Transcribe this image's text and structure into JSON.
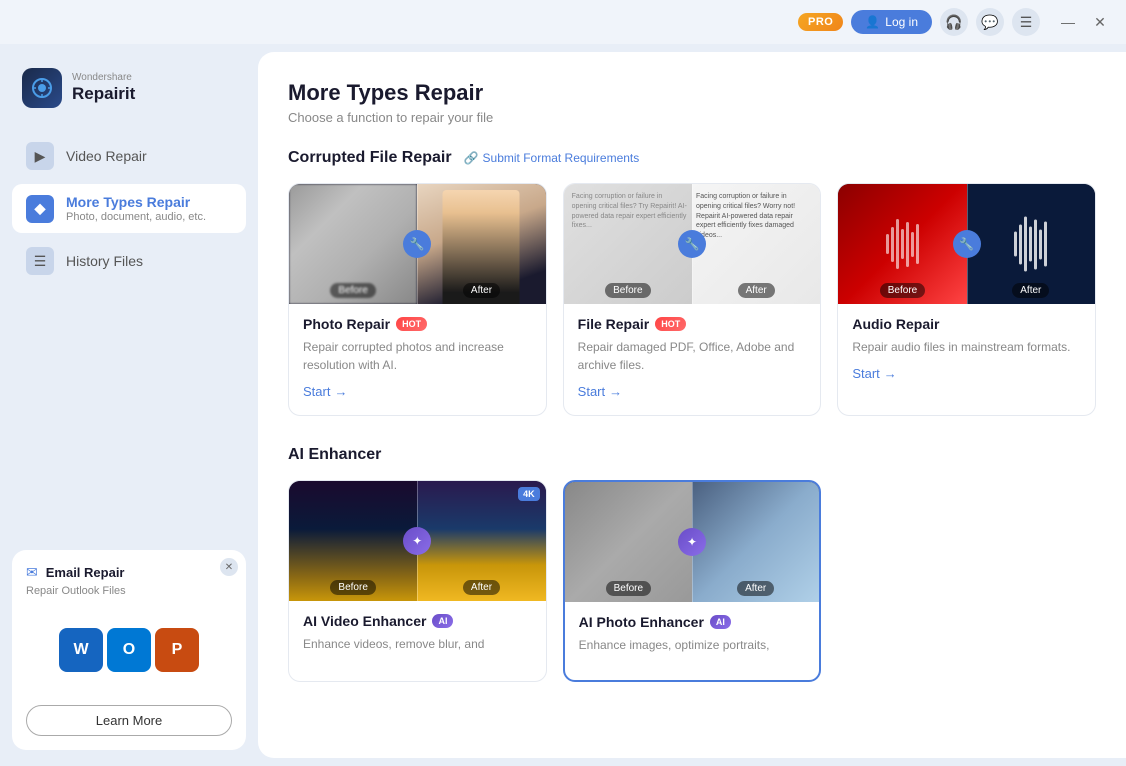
{
  "titlebar": {
    "pro_label": "PRO",
    "login_label": "Log in",
    "headphone_icon": "🎧",
    "chat_icon": "💬",
    "menu_icon": "☰",
    "minimize_icon": "—",
    "close_icon": "✕"
  },
  "app": {
    "brand": "Wondershare",
    "name": "Repairit"
  },
  "sidebar": {
    "items": [
      {
        "id": "video-repair",
        "label": "Video Repair",
        "icon": "▶",
        "active": false
      },
      {
        "id": "more-types-repair",
        "label": "More Types Repair",
        "sub": "Photo, document, audio, etc.",
        "icon": "◆",
        "active": true
      }
    ],
    "history_files": {
      "label": "History Files",
      "icon": "☰"
    }
  },
  "email_card": {
    "title": "Email Repair",
    "subtitle": "Repair Outlook Files",
    "learn_more": "Learn More"
  },
  "main": {
    "title": "More Types Repair",
    "subtitle": "Choose a function to repair your file",
    "corrupted_section": {
      "title": "Corrupted File Repair",
      "submit_link": "Submit Format Requirements"
    },
    "cards": [
      {
        "id": "photo-repair",
        "title": "Photo Repair",
        "badge": "HOT",
        "desc": "Repair corrupted photos and increase resolution with AI.",
        "start": "Start"
      },
      {
        "id": "file-repair",
        "title": "File Repair",
        "badge": "HOT",
        "desc": "Repair damaged PDF, Office, Adobe and archive files.",
        "start": "Start"
      },
      {
        "id": "audio-repair",
        "title": "Audio Repair",
        "badge": null,
        "desc": "Repair audio files in mainstream formats.",
        "start": "Start"
      }
    ],
    "ai_section": {
      "title": "AI Enhancer"
    },
    "ai_cards": [
      {
        "id": "ai-video-enhancer",
        "title": "AI Video Enhancer",
        "badge": "AI",
        "badge_4k": "4K",
        "desc": "Enhance videos, remove blur, and"
      },
      {
        "id": "ai-photo-enhancer",
        "title": "AI Photo Enhancer",
        "badge": "AI",
        "desc": "Enhance images, optimize portraits,"
      }
    ]
  }
}
